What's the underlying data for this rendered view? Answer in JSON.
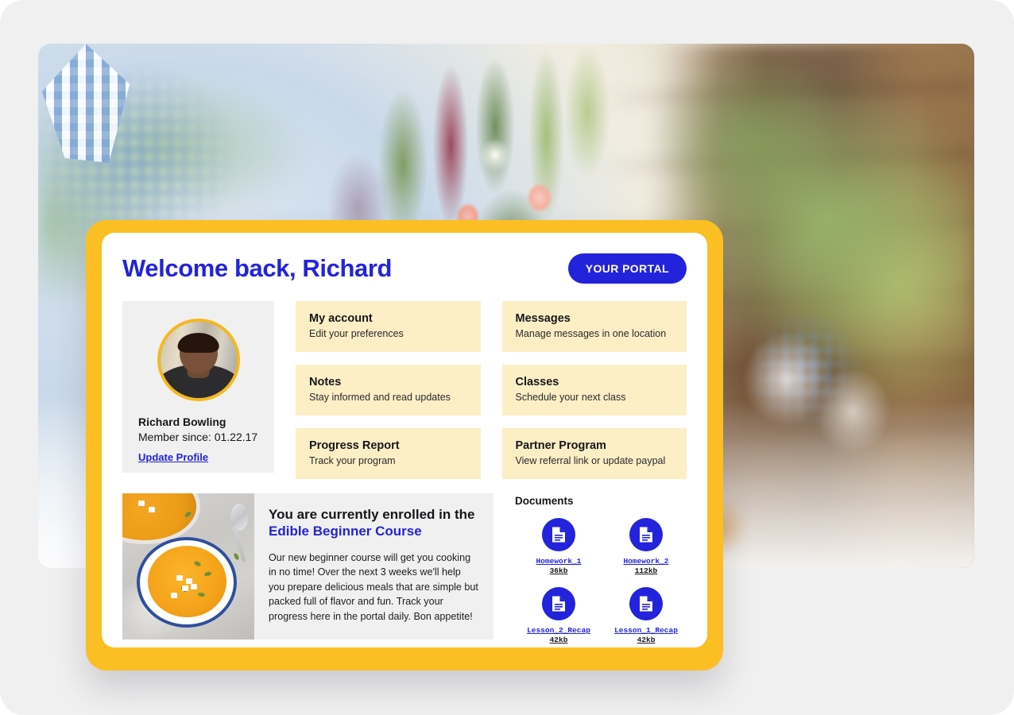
{
  "theme": {
    "brand_blue": "#2323DC",
    "frame_yellow": "#FBBF24",
    "tile_yellow": "#FCEFC5",
    "panel_grey": "#F0F0F0",
    "page_grey": "#F0F0F0",
    "avatar_ring": "#F5B820"
  },
  "hero": {
    "alt": "Blurred banquet table with pink rose bouquet, blue gingham napkins and glassware"
  },
  "header": {
    "title": "Welcome back, Richard",
    "portal_button": "YOUR PORTAL"
  },
  "profile": {
    "avatar_alt": "Portrait of Richard Bowling",
    "name": "Richard Bowling",
    "member_since": "Member since: 01.22.17",
    "update_link": "Update Profile"
  },
  "tiles_left": [
    {
      "title": "My account",
      "subtitle": "Edit your preferences"
    },
    {
      "title": "Notes",
      "subtitle": "Stay informed and read updates"
    },
    {
      "title": "Progress Report",
      "subtitle": "Track your program"
    }
  ],
  "tiles_right": [
    {
      "title": "Messages",
      "subtitle": "Manage messages in one location"
    },
    {
      "title": "Classes",
      "subtitle": "Schedule your next class"
    },
    {
      "title": "Partner Program",
      "subtitle": "View referral link or update paypal"
    }
  ],
  "enrollment": {
    "photo_alt": "Bowl of pumpkin soup with pepitas and feta",
    "heading_prefix": "You are currently enrolled in the ",
    "course_name": "Edible Beginner Course",
    "body": "Our new beginner course will get you cooking in no time! Over the next 3 weeks we'll help you prepare delicious meals that are simple but packed full of flavor and fun. Track your progress here in the portal daily. Bon appetite!"
  },
  "documents": {
    "title": "Documents",
    "items": [
      {
        "name": "Homework_1",
        "size": "36kb",
        "icon": "document-icon"
      },
      {
        "name": "Homework_2",
        "size": "112kb",
        "icon": "document-icon"
      },
      {
        "name": "Lesson_2_Recap",
        "size": "42kb",
        "icon": "document-icon"
      },
      {
        "name": "Lesson_1_Recap",
        "size": "42kb",
        "icon": "document-icon"
      }
    ]
  }
}
